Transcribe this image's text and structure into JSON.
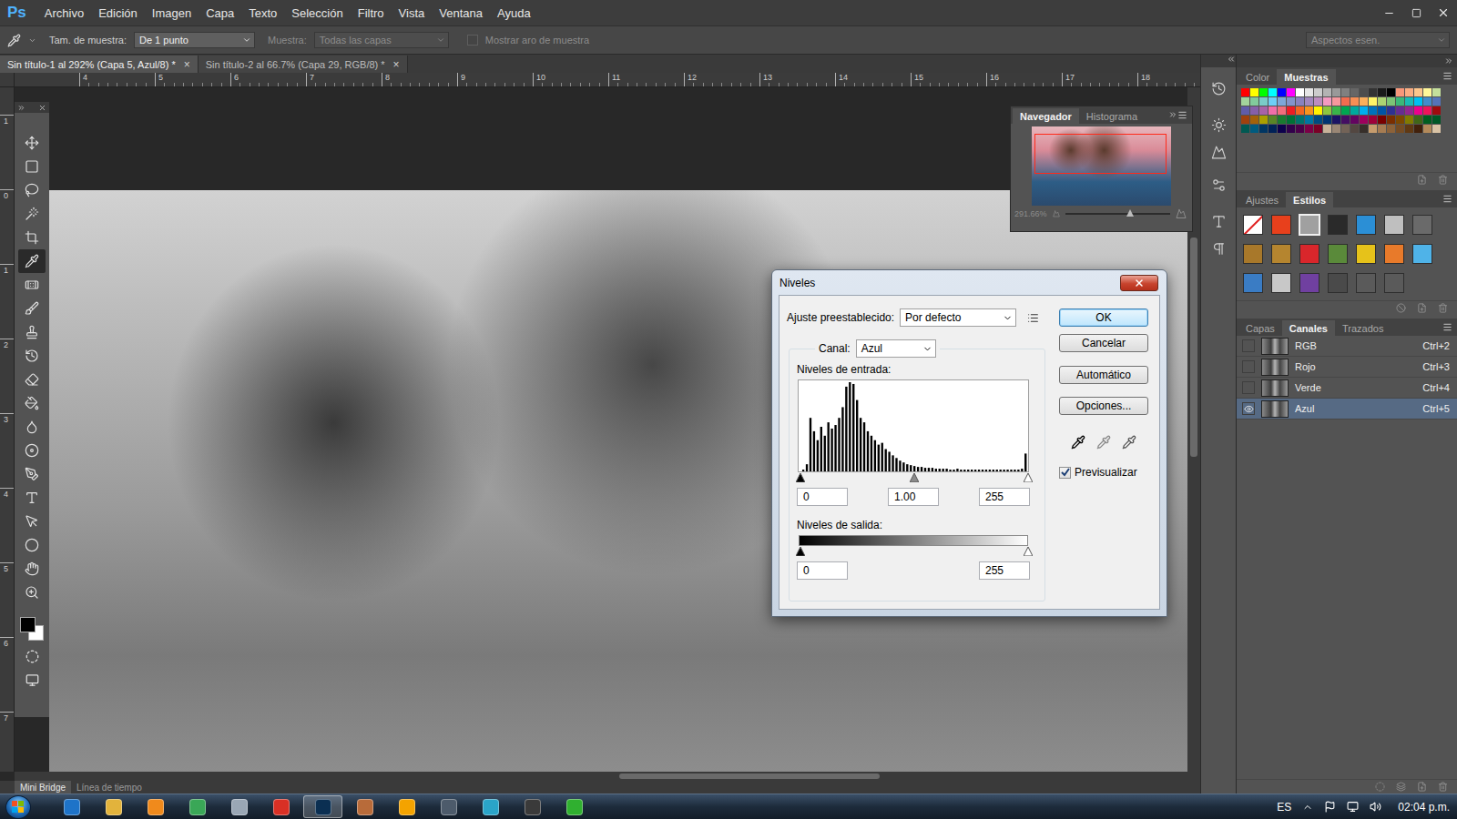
{
  "app_logo": "Ps",
  "menu": [
    "Archivo",
    "Edición",
    "Imagen",
    "Capa",
    "Texto",
    "Selección",
    "Filtro",
    "Vista",
    "Ventana",
    "Ayuda"
  ],
  "options_bar": {
    "sample_size_label": "Tam. de muestra:",
    "sample_size": "De 1 punto",
    "sample_label": "Muestra:",
    "sample": "Todas las capas",
    "sample_disabled": true,
    "ring_label": "Mostrar aro de muestra",
    "ring_checked": false,
    "ring_disabled": true,
    "workspace": "Aspectos esen."
  },
  "document_tabs": [
    {
      "label": "Sin título-1 al 292% (Capa 5, Azul/8) *",
      "close": "×",
      "selected": true
    },
    {
      "label": "Sin título-2 al 66.7% (Capa 29, RGB/8) *",
      "close": "×",
      "selected": false
    }
  ],
  "rulers": {
    "top": [
      "4",
      "5",
      "6",
      "7",
      "8",
      "9",
      "10",
      "11",
      "12",
      "13",
      "14",
      "15",
      "16",
      "17",
      "18"
    ],
    "left": [
      "1",
      "0",
      "1",
      "2",
      "3",
      "4",
      "5",
      "6",
      "7"
    ]
  },
  "tools": [
    {
      "selected": false
    },
    {
      "selected": false
    },
    {
      "selected": false
    },
    {
      "selected": false
    },
    {
      "selected": false
    },
    {
      "selected": true
    },
    {
      "selected": false
    },
    {
      "selected": false
    },
    {
      "selected": false
    },
    {
      "selected": false
    },
    {
      "selected": false
    },
    {
      "selected": false
    },
    {
      "selected": false
    },
    {
      "selected": false
    },
    {
      "selected": false
    },
    {
      "selected": false
    },
    {
      "selected": false
    },
    {
      "selected": false
    },
    {
      "selected": false
    },
    {
      "selected": false
    }
  ],
  "colors": {
    "foreground": "#000000",
    "background": "#ffffff"
  },
  "scrollbars": {
    "vertical": {
      "offset": 0.22,
      "size": 0.32
    },
    "horizontal": {
      "offset": 0.51,
      "size": 0.22
    }
  },
  "navigator": {
    "tabs": [
      {
        "label": "Navegador",
        "selected": true
      },
      {
        "label": "Histograma",
        "selected": false
      }
    ],
    "zoom": "291.66%",
    "level": 0.62
  },
  "levels_dialog": {
    "title": "Niveles",
    "preset_label": "Ajuste preestablecido:",
    "preset": "Por defecto",
    "channel_label": "Canal:",
    "channel": "Azul",
    "input_label": "Niveles de entrada:",
    "histogram": [
      0,
      2,
      8,
      60,
      45,
      35,
      50,
      40,
      55,
      48,
      52,
      60,
      72,
      95,
      100,
      98,
      80,
      60,
      55,
      45,
      40,
      35,
      30,
      32,
      25,
      22,
      18,
      15,
      12,
      10,
      8,
      7,
      6,
      5,
      5,
      4,
      4,
      4,
      3,
      3,
      3,
      3,
      2,
      2,
      3,
      2,
      2,
      2,
      2,
      2,
      2,
      2,
      2,
      2,
      2,
      2,
      2,
      2,
      2,
      2,
      2,
      2,
      3,
      20
    ],
    "input_values": [
      "0",
      "1.00",
      "255"
    ],
    "input_levels": [
      0,
      0.5,
      1
    ],
    "output_label": "Niveles de salida:",
    "output_values": [
      "0",
      "255"
    ],
    "output_levels": [
      0,
      1
    ],
    "buttons": [
      {
        "label": "OK",
        "default": true
      },
      {
        "label": "Cancelar",
        "default": false
      },
      {
        "label": "Automático",
        "default": false
      },
      {
        "label": "Opciones...",
        "default": false
      }
    ],
    "preview": {
      "label": "Previsualizar",
      "checked": true
    }
  },
  "swatch_tabs": [
    {
      "label": "Color",
      "selected": false
    },
    {
      "label": "Muestras",
      "selected": true
    }
  ],
  "swatches": [
    "#ff0000",
    "#ffff00",
    "#00ff00",
    "#00ffff",
    "#0000ff",
    "#ff00ff",
    "#ffffff",
    "#e6e6e6",
    "#cccccc",
    "#b3b3b3",
    "#999999",
    "#808080",
    "#666666",
    "#4d4d4d",
    "#333333",
    "#1a1a1a",
    "#000000",
    "#f7977a",
    "#fbad82",
    "#fdc68c",
    "#fff799",
    "#c4df9b",
    "#a3d39c",
    "#82ca9c",
    "#7accc8",
    "#6dcff6",
    "#7da7d9",
    "#8393ca",
    "#8882be",
    "#a187be",
    "#bc8dbf",
    "#f49ac2",
    "#f6989d",
    "#f26c4f",
    "#f68e55",
    "#fbaf5c",
    "#fff467",
    "#acd372",
    "#7cc576",
    "#3bb878",
    "#1abbb4",
    "#00bff3",
    "#438ccb",
    "#5574b9",
    "#605ca8",
    "#855fa8",
    "#a763a8",
    "#f06ea9",
    "#f26d7d",
    "#ed1c24",
    "#f26522",
    "#f7941d",
    "#fff200",
    "#8dc63f",
    "#39b54a",
    "#00a651",
    "#00a99d",
    "#00aeef",
    "#0072bc",
    "#0054a6",
    "#2e3192",
    "#662d91",
    "#92278f",
    "#ec008c",
    "#ed145b",
    "#9e0b0f",
    "#a0410d",
    "#a3620a",
    "#aba000",
    "#598527",
    "#1a7b30",
    "#007236",
    "#00746b",
    "#0076a3",
    "#004b80",
    "#003471",
    "#1b1464",
    "#440e62",
    "#630460",
    "#9e005d",
    "#9e0039",
    "#790000",
    "#7b2e00",
    "#7d4900",
    "#827b00",
    "#406618",
    "#005e20",
    "#005826",
    "#005952",
    "#005b7f",
    "#003663",
    "#002157",
    "#0d004c",
    "#32004b",
    "#4b0049",
    "#7b0046",
    "#7a0026",
    "#c7b299",
    "#998675",
    "#736357",
    "#534741",
    "#372f2a",
    "#c69c6d",
    "#a67c52",
    "#8c6239",
    "#754c24",
    "#603913",
    "#42210b",
    "#b38a5a",
    "#d9c3a5"
  ],
  "style_tabs": [
    {
      "label": "Ajustes",
      "selected": false
    },
    {
      "label": "Estilos",
      "selected": true
    }
  ],
  "styles": [
    {
      "color": "#ffffff",
      "selected": false
    },
    {
      "color": "#e8401c",
      "selected": false
    },
    {
      "color": "#a0a0a0",
      "selected": true
    },
    {
      "color": "#2a2a2a",
      "selected": false
    },
    {
      "color": "#2b8fd6",
      "selected": false
    },
    {
      "color": "#bfbfbf",
      "selected": false
    },
    {
      "color": "#6a6a6a",
      "selected": false
    },
    {
      "color": "#a8782a",
      "selected": false
    },
    {
      "color": "#b5852f",
      "selected": false
    },
    {
      "color": "#d9262b",
      "selected": false
    },
    {
      "color": "#5a8a3a",
      "selected": false
    },
    {
      "color": "#e6c21a",
      "selected": false
    },
    {
      "color": "#e87a2a",
      "selected": false
    },
    {
      "color": "#4fb3e8",
      "selected": false
    },
    {
      "color": "#3a7cc4",
      "selected": false
    },
    {
      "color": "#c8c8c8",
      "selected": false
    },
    {
      "color": "#7040a0",
      "selected": false
    },
    {
      "color": "#4a4a4a",
      "selected": false
    },
    {
      "color": "#5a5a5a",
      "selected": false
    },
    {
      "color": "#5a5a5a",
      "selected": false
    }
  ],
  "channel_tabs": [
    {
      "label": "Capas",
      "selected": false
    },
    {
      "label": "Canales",
      "selected": true
    },
    {
      "label": "Trazados",
      "selected": false
    }
  ],
  "channels": [
    {
      "name": "RGB",
      "shortcut": "Ctrl+2",
      "visible": false,
      "selected": false
    },
    {
      "name": "Rojo",
      "shortcut": "Ctrl+3",
      "visible": false,
      "selected": false
    },
    {
      "name": "Verde",
      "shortcut": "Ctrl+4",
      "visible": false,
      "selected": false
    },
    {
      "name": "Azul",
      "shortcut": "Ctrl+5",
      "visible": true,
      "selected": true
    }
  ],
  "bottom_tabs": [
    {
      "label": "Mini Bridge",
      "selected": true
    },
    {
      "label": "Línea de tiempo",
      "selected": false
    }
  ],
  "taskbar": {
    "apps": [
      {
        "color": "#1e73c8",
        "selected": false
      },
      {
        "color": "#e2b33c",
        "selected": false
      },
      {
        "color": "#f08a1c",
        "selected": false
      },
      {
        "color": "#3aa757",
        "selected": false
      },
      {
        "color": "#9aa7b5",
        "selected": false
      },
      {
        "color": "#d93025",
        "selected": false
      },
      {
        "color": "#0b2f52",
        "selected": true
      },
      {
        "color": "#b86b3a",
        "selected": false
      },
      {
        "color": "#f4a300",
        "selected": false
      },
      {
        "color": "#4d5b6b",
        "selected": false
      },
      {
        "color": "#2aa4c8",
        "selected": false
      },
      {
        "color": "#3a3a3a",
        "selected": false
      },
      {
        "color": "#30b030",
        "selected": false
      }
    ],
    "language": "ES",
    "time": "02:04 p.m."
  }
}
